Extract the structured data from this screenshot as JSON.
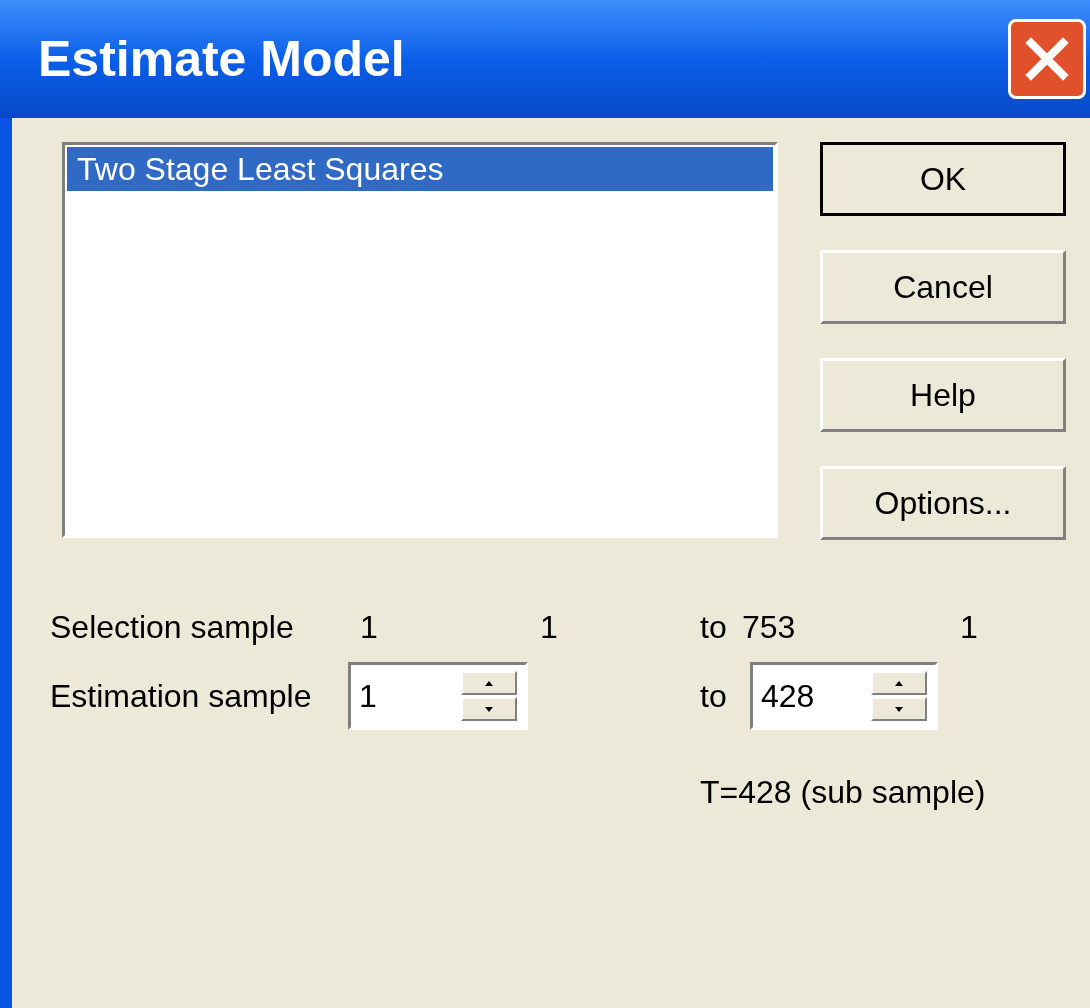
{
  "window": {
    "title": "Estimate Model"
  },
  "methods": [
    {
      "label": "Two Stage Least Squares",
      "selected": true
    }
  ],
  "buttons": [
    {
      "label": "OK",
      "default": true
    },
    {
      "label": "Cancel",
      "default": false
    },
    {
      "label": "Help",
      "default": false
    },
    {
      "label": "Options...",
      "default": false
    }
  ],
  "selection_sample": {
    "label": "Selection sample",
    "start": "1",
    "start_2": "1",
    "to": "to",
    "end": "753",
    "end_2": "1"
  },
  "estimation_sample": {
    "label": "Estimation sample",
    "start": "1",
    "to": "to",
    "end": "428"
  },
  "summary": "T=428 (sub sample)"
}
